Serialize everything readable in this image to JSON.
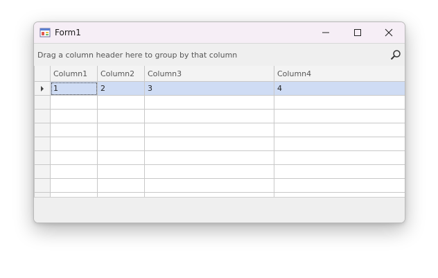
{
  "window": {
    "title": "Form1",
    "icons": [
      "app-icon",
      "minimize-icon",
      "maximize-icon",
      "close-icon"
    ]
  },
  "group_panel": {
    "text": "Drag a column header here to group by that column",
    "search_icon": "search-icon"
  },
  "grid": {
    "columns": [
      "Column1",
      "Column2",
      "Column3",
      "Column4"
    ],
    "rows": [
      [
        "1",
        "2",
        "3",
        "4"
      ]
    ],
    "empty_rows": 8,
    "selected_color": "#cfdcf4"
  }
}
